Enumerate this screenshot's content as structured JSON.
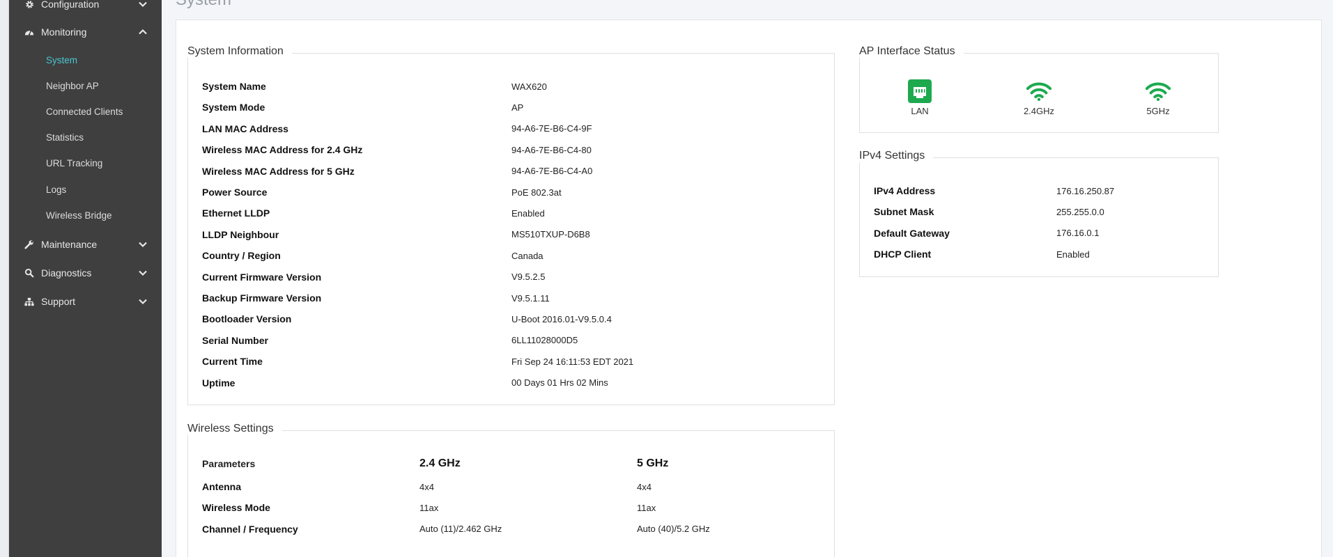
{
  "sidebar": {
    "groups": [
      {
        "label": "Configuration",
        "icon": "gear-icon",
        "expanded": false
      },
      {
        "label": "Monitoring",
        "icon": "dashboard-icon",
        "expanded": true
      },
      {
        "label": "Maintenance",
        "icon": "wrench-icon",
        "expanded": false
      },
      {
        "label": "Diagnostics",
        "icon": "search-icon",
        "expanded": false
      },
      {
        "label": "Support",
        "icon": "sitemap-icon",
        "expanded": false
      }
    ],
    "monitoring_items": [
      {
        "label": "System",
        "active": true
      },
      {
        "label": "Neighbor AP"
      },
      {
        "label": "Connected Clients"
      },
      {
        "label": "Statistics"
      },
      {
        "label": "URL Tracking"
      },
      {
        "label": "Logs"
      },
      {
        "label": "Wireless Bridge"
      }
    ]
  },
  "page": {
    "title": "System"
  },
  "system_info": {
    "title": "System Information",
    "rows": [
      {
        "key": "System Name",
        "value": "WAX620"
      },
      {
        "key": "System Mode",
        "value": "AP"
      },
      {
        "key": "LAN MAC Address",
        "value": "94-A6-7E-B6-C4-9F"
      },
      {
        "key": "Wireless MAC Address for 2.4 GHz",
        "value": "94-A6-7E-B6-C4-80"
      },
      {
        "key": "Wireless MAC Address for 5 GHz",
        "value": "94-A6-7E-B6-C4-A0"
      },
      {
        "key": "Power Source",
        "value": "PoE 802.3at"
      },
      {
        "key": "Ethernet LLDP",
        "value": "Enabled"
      },
      {
        "key": "LLDP Neighbour",
        "value": "MS510TXUP-D6B8"
      },
      {
        "key": "Country / Region",
        "value": "Canada"
      },
      {
        "key": "Current Firmware Version",
        "value": "V9.5.2.5"
      },
      {
        "key": "Backup Firmware Version",
        "value": "V9.5.1.11"
      },
      {
        "key": "Bootloader Version",
        "value": "U-Boot 2016.01-V9.5.0.4"
      },
      {
        "key": "Serial Number",
        "value": "6LL11028000D5"
      },
      {
        "key": "Current Time",
        "value": "Fri Sep 24 16:11:53 EDT 2021"
      },
      {
        "key": "Uptime",
        "value": "00 Days 01 Hrs 02 Mins"
      }
    ]
  },
  "ap_interface": {
    "title": "AP Interface Status",
    "items": [
      {
        "label": "LAN",
        "icon": "ethernet-port-icon"
      },
      {
        "label": "2.4GHz",
        "icon": "wifi-icon"
      },
      {
        "label": "5GHz",
        "icon": "wifi-icon"
      }
    ],
    "color": "#1ea94f"
  },
  "ipv4": {
    "title": "IPv4 Settings",
    "rows": [
      {
        "key": "IPv4 Address",
        "value": "176.16.250.87"
      },
      {
        "key": "Subnet Mask",
        "value": "255.255.0.0"
      },
      {
        "key": "Default Gateway",
        "value": "176.16.0.1"
      },
      {
        "key": "DHCP Client",
        "value": "Enabled"
      }
    ]
  },
  "wireless": {
    "title": "Wireless Settings",
    "headers": [
      "Parameters",
      "2.4 GHz",
      "5 GHz"
    ],
    "rows": [
      [
        "Antenna",
        "4x4",
        "4x4"
      ],
      [
        "Wireless Mode",
        "11ax",
        "11ax"
      ],
      [
        "Channel / Frequency",
        "Auto (11)/2.462 GHz",
        "Auto (40)/5.2 GHz"
      ]
    ]
  }
}
